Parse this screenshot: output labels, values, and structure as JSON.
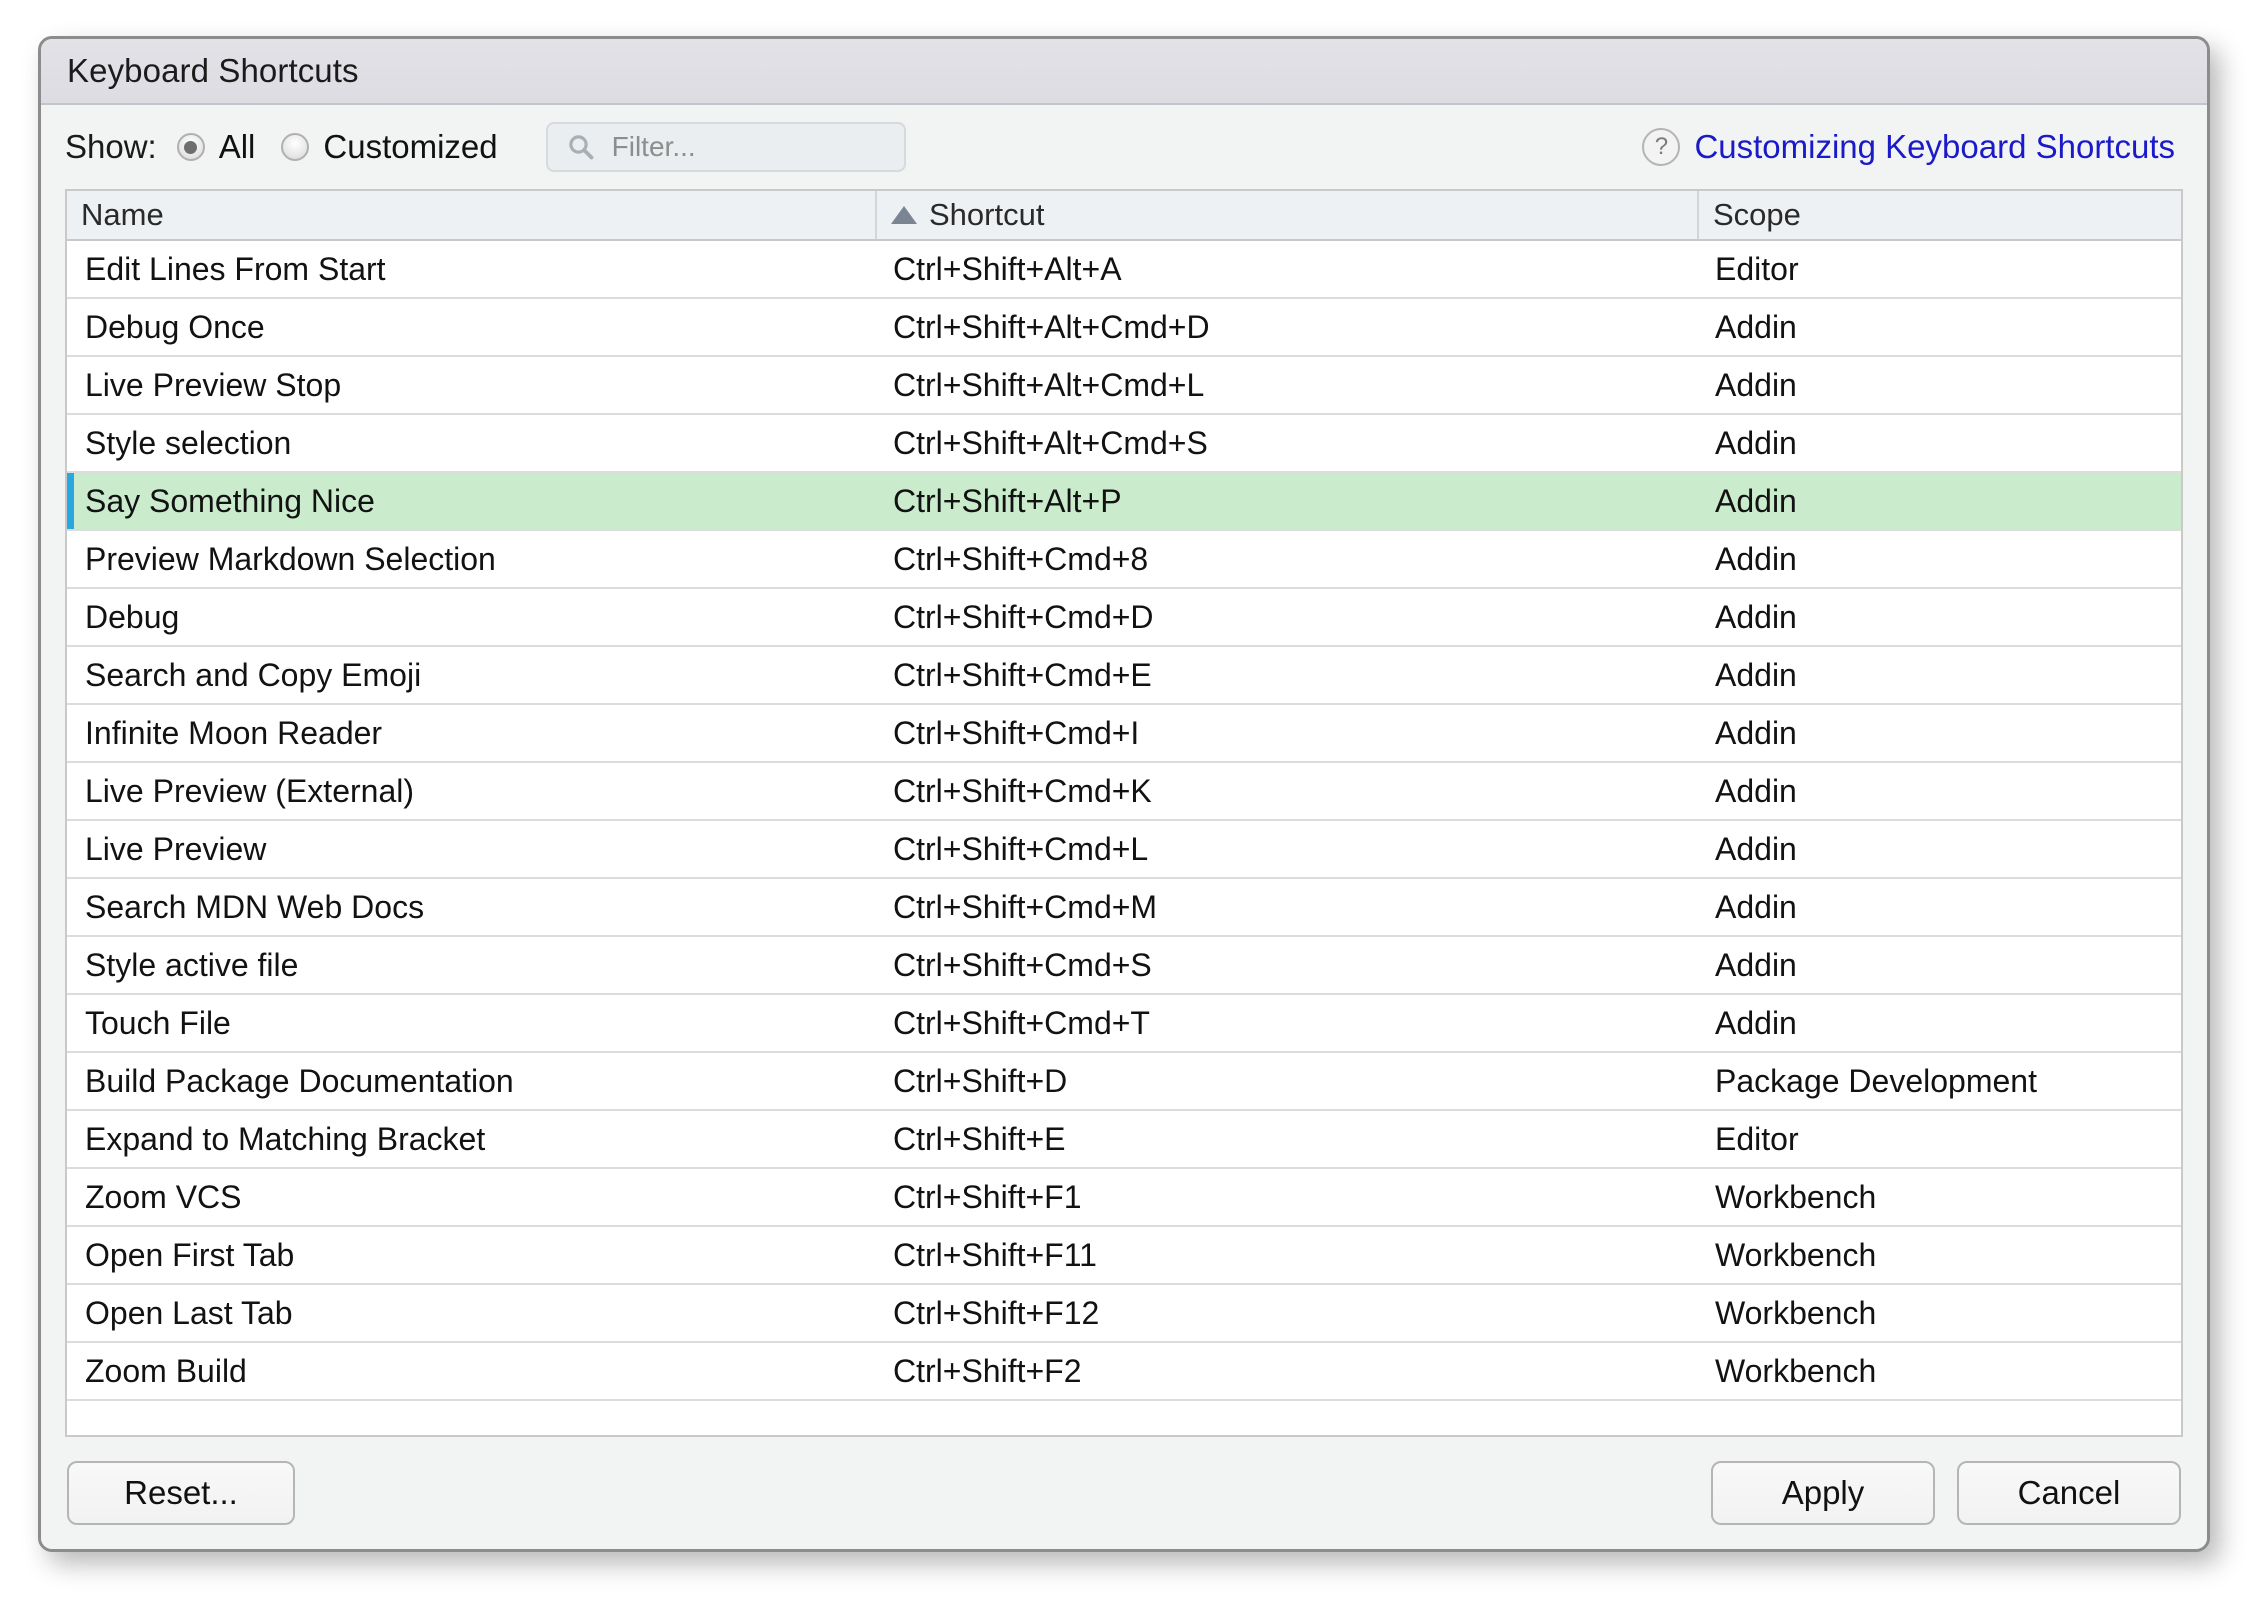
{
  "window": {
    "title": "Keyboard Shortcuts"
  },
  "toolbar": {
    "show_label": "Show:",
    "radios": [
      {
        "label": "All",
        "checked": true
      },
      {
        "label": "Customized",
        "checked": false
      }
    ],
    "filter": {
      "value": "",
      "placeholder": "Filter...",
      "icon": "search-icon"
    },
    "help": {
      "icon": "question-mark-icon",
      "link_label": "Customizing Keyboard Shortcuts",
      "link_color": "#1a1ac8"
    }
  },
  "table": {
    "columns": [
      {
        "label": "Name",
        "sorted": false
      },
      {
        "label": "Shortcut",
        "sorted": true,
        "sort_direction": "ascending"
      },
      {
        "label": "Scope",
        "sorted": false
      }
    ],
    "selected_row_index": 4,
    "selection_color": "#caeccc",
    "selection_marker_color": "#29a8e0",
    "rows": [
      {
        "name": "Edit Lines From Start",
        "shortcut": "Ctrl+Shift+Alt+A",
        "scope": "Editor"
      },
      {
        "name": "Debug Once",
        "shortcut": "Ctrl+Shift+Alt+Cmd+D",
        "scope": "Addin"
      },
      {
        "name": "Live Preview Stop",
        "shortcut": "Ctrl+Shift+Alt+Cmd+L",
        "scope": "Addin"
      },
      {
        "name": "Style selection",
        "shortcut": "Ctrl+Shift+Alt+Cmd+S",
        "scope": "Addin"
      },
      {
        "name": "Say Something Nice",
        "shortcut": "Ctrl+Shift+Alt+P",
        "scope": "Addin"
      },
      {
        "name": "Preview Markdown Selection",
        "shortcut": "Ctrl+Shift+Cmd+8",
        "scope": "Addin"
      },
      {
        "name": "Debug",
        "shortcut": "Ctrl+Shift+Cmd+D",
        "scope": "Addin"
      },
      {
        "name": "Search and Copy Emoji",
        "shortcut": "Ctrl+Shift+Cmd+E",
        "scope": "Addin"
      },
      {
        "name": "Infinite Moon Reader",
        "shortcut": "Ctrl+Shift+Cmd+I",
        "scope": "Addin"
      },
      {
        "name": "Live Preview (External)",
        "shortcut": "Ctrl+Shift+Cmd+K",
        "scope": "Addin"
      },
      {
        "name": "Live Preview",
        "shortcut": "Ctrl+Shift+Cmd+L",
        "scope": "Addin"
      },
      {
        "name": "Search MDN Web Docs",
        "shortcut": "Ctrl+Shift+Cmd+M",
        "scope": "Addin"
      },
      {
        "name": "Style active file",
        "shortcut": "Ctrl+Shift+Cmd+S",
        "scope": "Addin"
      },
      {
        "name": "Touch File",
        "shortcut": "Ctrl+Shift+Cmd+T",
        "scope": "Addin"
      },
      {
        "name": "Build Package Documentation",
        "shortcut": "Ctrl+Shift+D",
        "scope": "Package Development"
      },
      {
        "name": "Expand to Matching Bracket",
        "shortcut": "Ctrl+Shift+E",
        "scope": "Editor"
      },
      {
        "name": "Zoom VCS",
        "shortcut": "Ctrl+Shift+F1",
        "scope": "Workbench"
      },
      {
        "name": "Open First Tab",
        "shortcut": "Ctrl+Shift+F11",
        "scope": "Workbench"
      },
      {
        "name": "Open Last Tab",
        "shortcut": "Ctrl+Shift+F12",
        "scope": "Workbench"
      },
      {
        "name": "Zoom Build",
        "shortcut": "Ctrl+Shift+F2",
        "scope": "Workbench"
      }
    ]
  },
  "footer": {
    "reset_label": "Reset...",
    "apply_label": "Apply",
    "cancel_label": "Cancel"
  }
}
